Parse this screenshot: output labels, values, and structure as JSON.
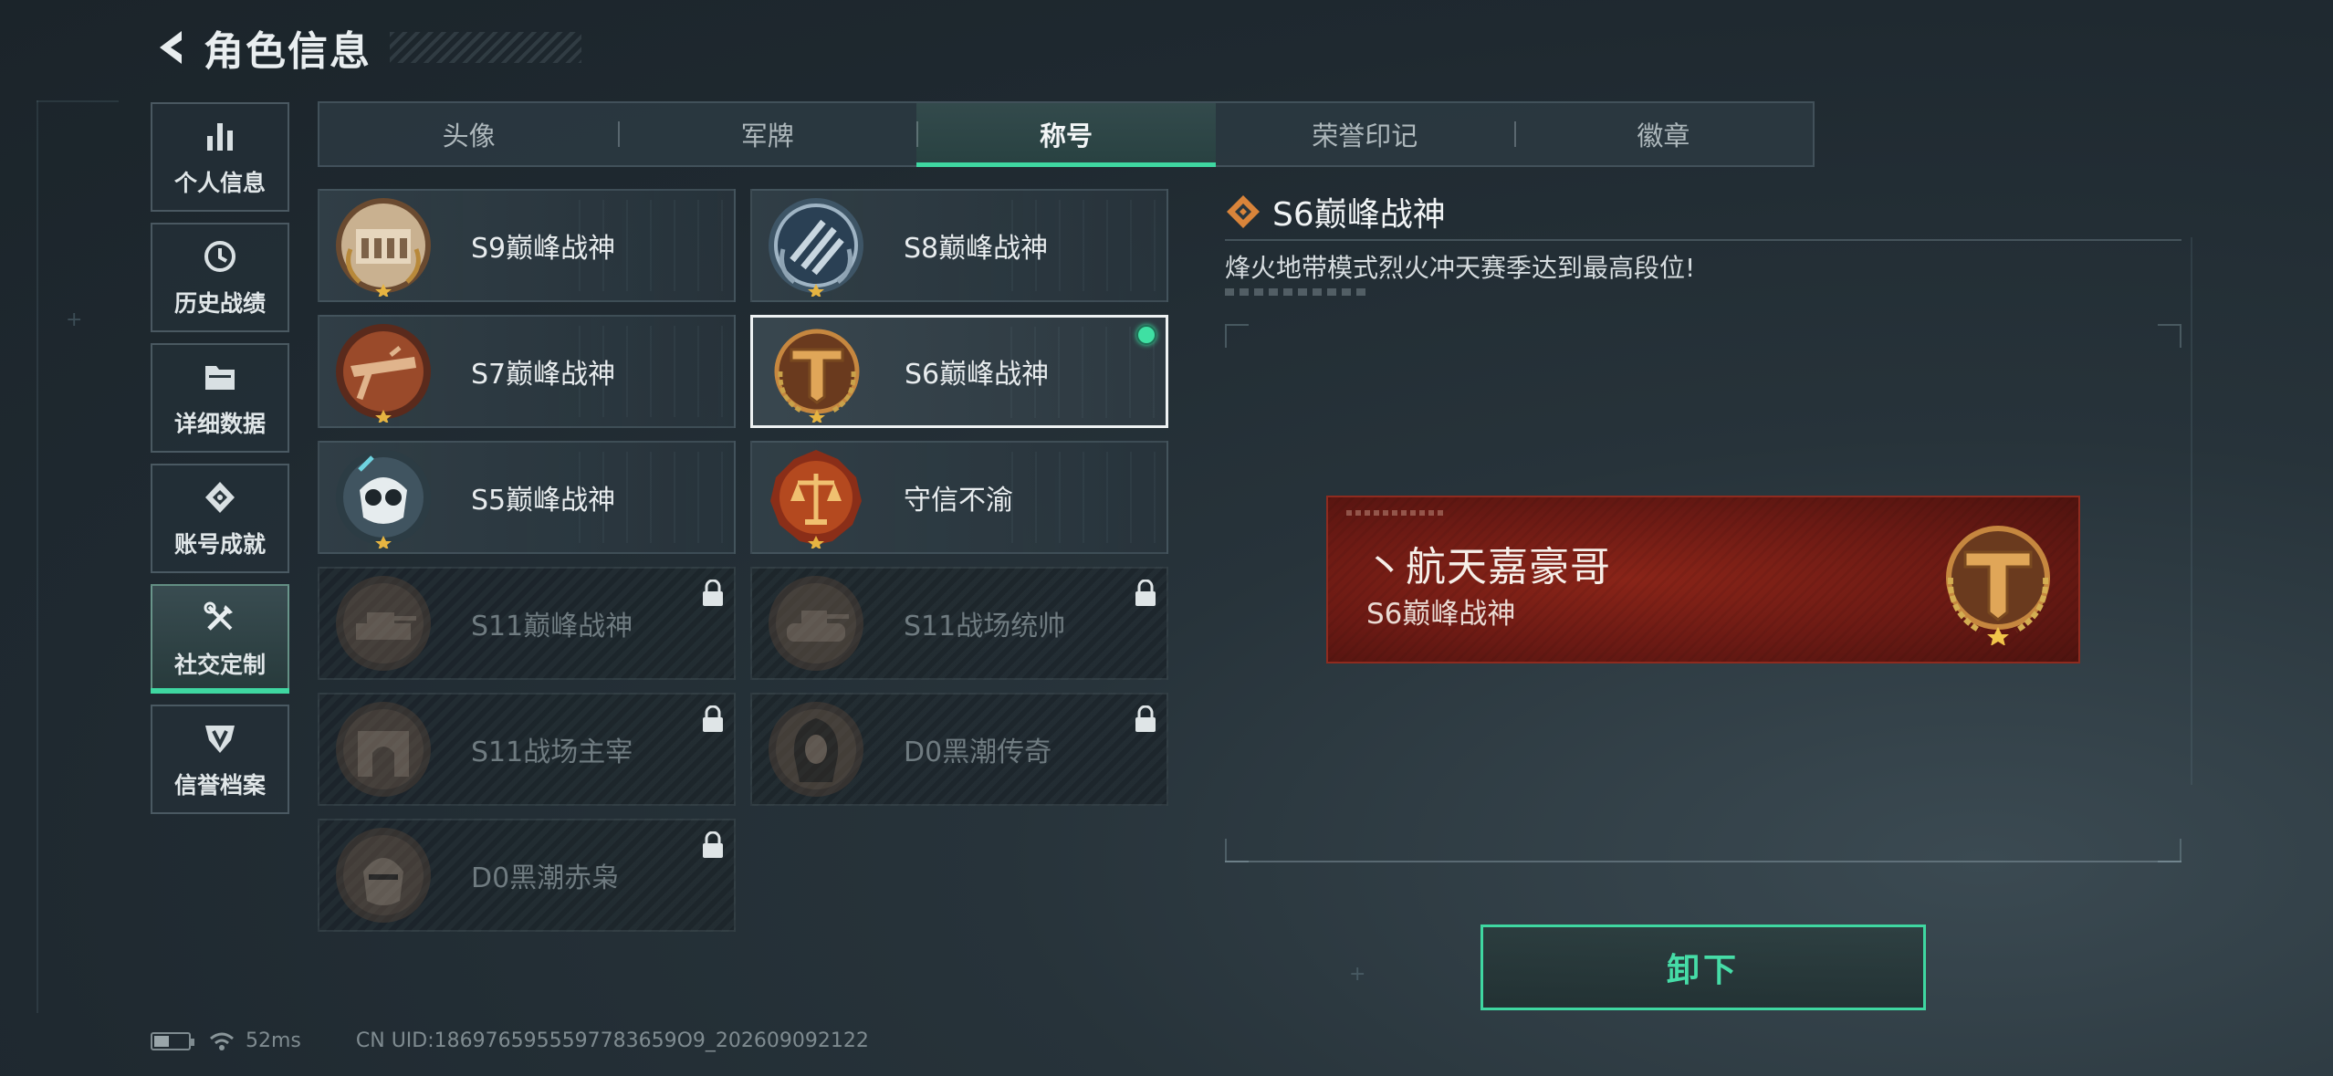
{
  "header": {
    "title": "角色信息"
  },
  "side_nav": [
    {
      "label": "个人信息",
      "icon": "bar-chart-icon",
      "active": false
    },
    {
      "label": "历史战绩",
      "icon": "clock-history-icon",
      "active": false
    },
    {
      "label": "详细数据",
      "icon": "folder-icon",
      "active": false
    },
    {
      "label": "账号成就",
      "icon": "achievement-icon",
      "active": false
    },
    {
      "label": "社交定制",
      "icon": "tools-icon",
      "active": true
    },
    {
      "label": "信誉档案",
      "icon": "shield-icon",
      "active": false
    }
  ],
  "tabs": [
    {
      "label": "头像",
      "active": false
    },
    {
      "label": "军牌",
      "active": false
    },
    {
      "label": "称号",
      "active": true
    },
    {
      "label": "荣誉印记",
      "active": false
    },
    {
      "label": "徽章",
      "active": false
    }
  ],
  "titles": [
    {
      "name": "S9巅峰战神",
      "medal": "arch-building-medal",
      "locked": false,
      "selected": false
    },
    {
      "name": "S8巅峰战神",
      "medal": "blue-stripes-medal",
      "locked": false,
      "selected": false
    },
    {
      "name": "S7巅峰战神",
      "medal": "crossbow-medal",
      "locked": false,
      "selected": false
    },
    {
      "name": "S6巅峰战神",
      "medal": "t-emblem-medal",
      "locked": false,
      "selected": true,
      "equipped": true
    },
    {
      "name": "S5巅峰战神",
      "medal": "skull-mask-medal",
      "locked": false,
      "selected": false
    },
    {
      "name": "守信不渝",
      "medal": "scales-medal",
      "locked": false,
      "selected": false
    },
    {
      "name": "S11巅峰战神",
      "medal": "tank-medal",
      "locked": true,
      "selected": false
    },
    {
      "name": "S11战场统帅",
      "medal": "tank-medal",
      "locked": true,
      "selected": false
    },
    {
      "name": "S11战场主宰",
      "medal": "arch-gate-medal",
      "locked": true,
      "selected": false
    },
    {
      "name": "D0黑潮传奇",
      "medal": "hooded-figure-medal",
      "locked": true,
      "selected": false
    },
    {
      "name": "D0黑潮赤枭",
      "medal": "helmet-medal",
      "locked": true,
      "selected": false
    }
  ],
  "detail": {
    "title": "S6巅峰战神",
    "description": "烽火地带模式烈火冲天赛季达到最高段位!",
    "preview_player_name": "丶航天嘉豪哥",
    "preview_title": "S6巅峰战神",
    "action_label": "卸下"
  },
  "status_bar": {
    "battery_level": 0.45,
    "ping": "52ms",
    "uid": "CN UID:1869765955597783659O9_202609092122"
  },
  "colors": {
    "accent": "#3fd7a1",
    "nameplate": "#7a1f16",
    "bronze": "#a8743f"
  }
}
